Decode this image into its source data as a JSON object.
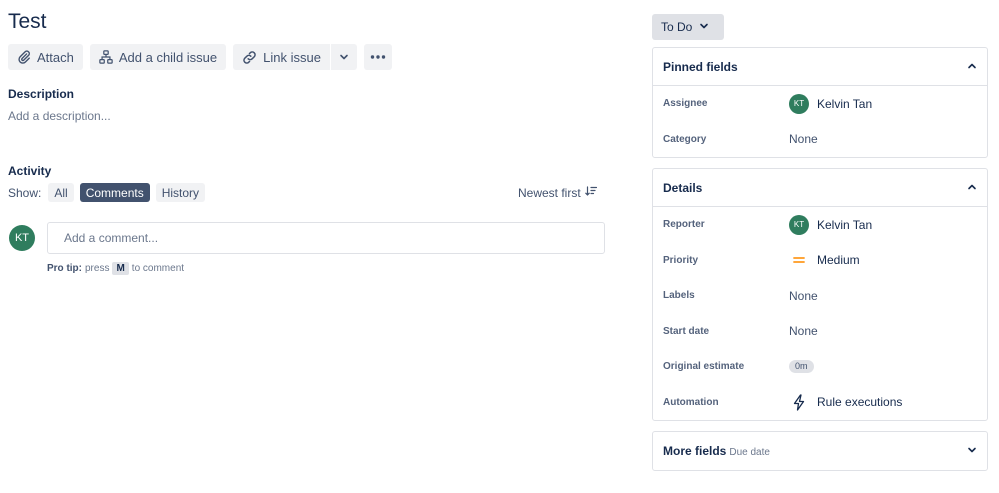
{
  "issue": {
    "title": "Test"
  },
  "toolbar": {
    "attach_label": "Attach",
    "child_issue_label": "Add a child issue",
    "link_issue_label": "Link issue"
  },
  "description": {
    "label": "Description",
    "placeholder": "Add a description..."
  },
  "activity": {
    "label": "Activity",
    "show_label": "Show:",
    "filters": [
      "All",
      "Comments",
      "History"
    ],
    "active_filter": "Comments",
    "sort_label": "Newest first"
  },
  "comment": {
    "avatar_initials": "KT",
    "placeholder": "Add a comment...",
    "protip_label": "Pro tip:",
    "protip_pre": "press",
    "protip_key": "M",
    "protip_post": "to comment"
  },
  "status": {
    "label": "To Do"
  },
  "pinned": {
    "title": "Pinned fields",
    "fields": {
      "assignee_label": "Assignee",
      "assignee_initials": "KT",
      "assignee_value": "Kelvin Tan",
      "category_label": "Category",
      "category_value": "None"
    }
  },
  "details": {
    "title": "Details",
    "reporter_label": "Reporter",
    "reporter_initials": "KT",
    "reporter_value": "Kelvin Tan",
    "priority_label": "Priority",
    "priority_value": "Medium",
    "labels_label": "Labels",
    "labels_value": "None",
    "start_date_label": "Start date",
    "start_date_value": "None",
    "estimate_label": "Original estimate",
    "estimate_value": "0m",
    "automation_label": "Automation",
    "automation_value": "Rule executions"
  },
  "more_fields": {
    "title": "More fields",
    "hint": "Due date"
  },
  "colors": {
    "avatar": "#2f7d5e",
    "priority_medium": "#ff991f",
    "active_chip": "#42526e"
  },
  "icons": {
    "attach": "paperclip-icon",
    "child": "hierarchy-icon",
    "link": "link-icon",
    "more": "ellipsis-icon",
    "sort": "sort-icon",
    "automation": "lightning-icon"
  }
}
